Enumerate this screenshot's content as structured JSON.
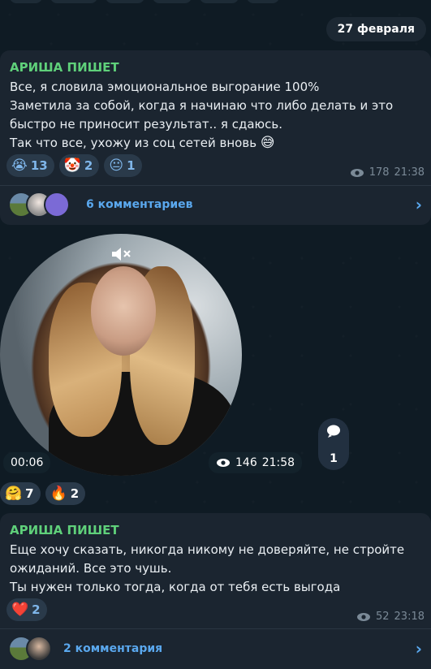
{
  "date_chip": "27 февраля",
  "post1": {
    "author": "АРИША ПИШЕТ",
    "lines": [
      "Все, я словила эмоциональное выгорание 100%",
      "Заметила за собой, когда я начинаю что либо делать и это",
      "быстро не приносит результат.. я сдаюсь.",
      "Так что все, ухожу из соц сетей вновь"
    ],
    "trailing_emoji": "😅",
    "reactions": [
      {
        "emoji": "😭",
        "count": "13"
      },
      {
        "emoji": "🤡",
        "count": "2"
      },
      {
        "emoji": "😐",
        "count": "1"
      }
    ],
    "views": "178",
    "time": "21:38",
    "comments_label": "6 комментариев"
  },
  "video": {
    "duration": "00:06",
    "views": "146",
    "time": "21:58",
    "comment_count": "1",
    "icons": {
      "mute": "speaker-muted-icon",
      "comment": "comment-bubble-icon"
    },
    "reactions": [
      {
        "emoji": "🤗",
        "count": "7"
      },
      {
        "emoji": "🔥",
        "count": "2"
      }
    ]
  },
  "post2": {
    "author": "АРИША ПИШЕТ",
    "lines": [
      "Еще хочу сказать, никогда никому не доверяйте, не стройте",
      "ожиданий. Все это чушь.",
      "Ты нужен только тогда, когда от тебя есть выгода"
    ],
    "reactions": [
      {
        "emoji": "❤️",
        "count": "2"
      }
    ],
    "views": "52",
    "time": "23:18",
    "comments_label": "2 комментария"
  },
  "colors": {
    "accent": "#5aa8ee",
    "author": "#5fd07a",
    "bubble": "#1b2530",
    "background": "#0f1b24"
  }
}
